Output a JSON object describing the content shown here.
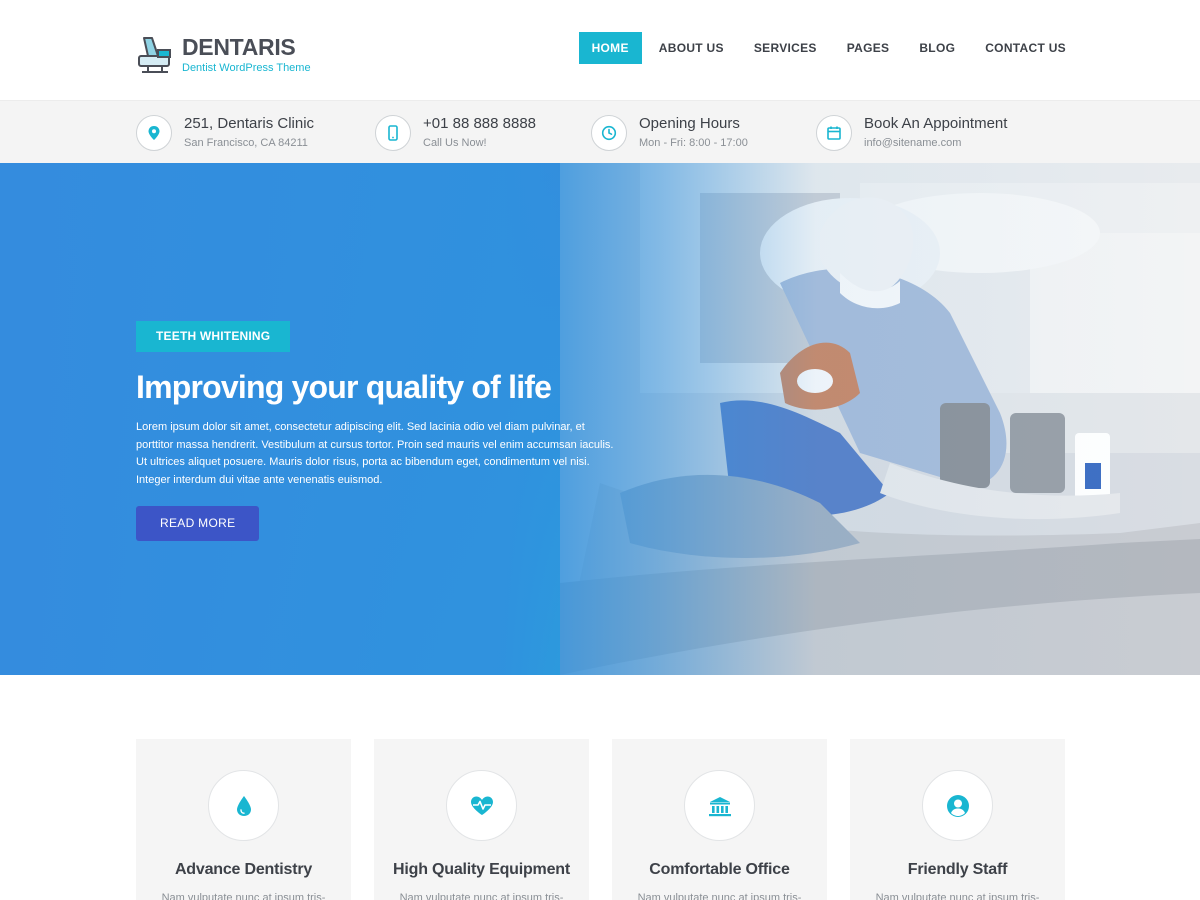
{
  "brand": {
    "name": "DENTARIS",
    "tagline": "Dentist WordPress Theme",
    "accent_color": "#19b6d1"
  },
  "nav": {
    "items": [
      {
        "label": "HOME",
        "active": true
      },
      {
        "label": "ABOUT US",
        "active": false
      },
      {
        "label": "SERVICES",
        "active": false
      },
      {
        "label": "PAGES",
        "active": false
      },
      {
        "label": "BLOG",
        "active": false
      },
      {
        "label": "CONTACT US",
        "active": false
      }
    ]
  },
  "infobar": {
    "items": [
      {
        "icon": "location-pin-icon",
        "title": "251, Dentaris Clinic",
        "subtitle": "San Francisco, CA 84211"
      },
      {
        "icon": "mobile-phone-icon",
        "title": "+01 88 888 8888",
        "subtitle": "Call Us Now!"
      },
      {
        "icon": "clock-icon",
        "title": "Opening Hours",
        "subtitle": "Mon - Fri: 8:00 - 17:00"
      },
      {
        "icon": "calendar-icon",
        "title": "Book An Appointment",
        "subtitle": "info@sitename.com"
      }
    ]
  },
  "hero": {
    "tag": "TEETH WHITENING",
    "title": "Improving your quality of life",
    "text": "Lorem ipsum dolor sit amet, consectetur adipiscing elit. Sed lacinia odio vel diam pulvinar, et porttitor massa hendrerit. Vestibulum at cursus tortor. Proin sed mauris vel enim accumsan iaculis. Ut ultrices aliquet posuere. Mauris dolor risus, porta ac bibendum eget, condimentum vel nisi. Integer interdum dui vitae ante venenatis euismod.",
    "button_label": "READ MORE",
    "button_color": "#3c55c7"
  },
  "features": [
    {
      "icon": "water-drop-icon",
      "title": "Advance Dentistry",
      "text": "Nam vulputate nunc at ipsum tris-"
    },
    {
      "icon": "heartbeat-icon",
      "title": "High Quality Equipment",
      "text": "Nam vulputate nunc at ipsum tris-"
    },
    {
      "icon": "building-icon",
      "title": "Comfortable Office",
      "text": "Nam vulputate nunc at ipsum tris-"
    },
    {
      "icon": "user-icon",
      "title": "Friendly Staff",
      "text": "Nam vulputate nunc at ipsum tris-"
    }
  ]
}
